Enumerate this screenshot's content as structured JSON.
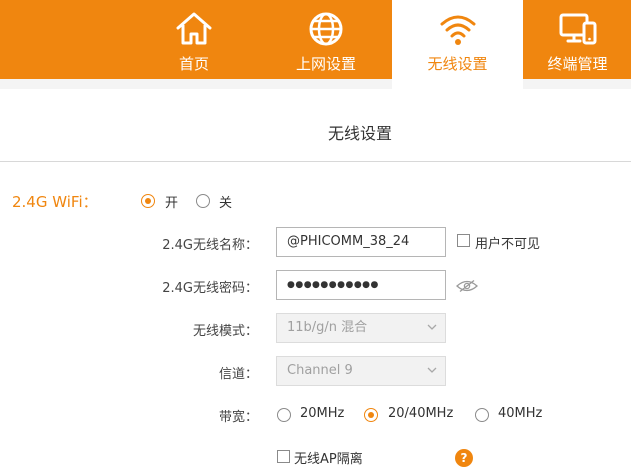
{
  "nav": {
    "items": [
      {
        "label": "首页",
        "icon": "home-icon"
      },
      {
        "label": "上网设置",
        "icon": "globe-icon"
      },
      {
        "label": "无线设置",
        "icon": "wifi-icon",
        "active": true
      },
      {
        "label": "终端管理",
        "icon": "devices-icon"
      }
    ]
  },
  "section": {
    "title": "无线设置"
  },
  "wifi24": {
    "band_label": "2.4G WiFi：",
    "on_label": "开",
    "off_label": "关",
    "enabled": true,
    "ssid_label": "2.4G无线名称：",
    "ssid_value": "@PHICOMM_38_24",
    "hide_ssid_label": "用户不可见",
    "password_label": "2.4G无线密码：",
    "password_value": "●●●●●●●●●●●",
    "mode_label": "无线模式：",
    "mode_value": "11b/g/n 混合",
    "channel_label": "信道：",
    "channel_value": "Channel 9",
    "bandwidth_label": "带宽：",
    "bandwidth_options": [
      "20MHz",
      "20/40MHz",
      "40MHz"
    ],
    "bandwidth_selected": "20/40MHz",
    "ap_isolation_label": "无线AP隔离",
    "help_symbol": "?"
  },
  "colors": {
    "accent": "#f0860f",
    "nav_bg": "#f0860f",
    "text": "#333333"
  }
}
